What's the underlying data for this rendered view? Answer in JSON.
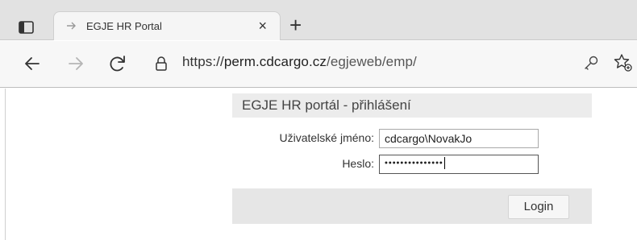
{
  "browser": {
    "tab": {
      "title": "EGJE HR Portal",
      "close_label": "×"
    },
    "new_tab_label": "+",
    "address_bar": {
      "url_prefix": "https://",
      "url_host": "perm.cdcargo.cz",
      "url_path": "/egjeweb/emp/"
    },
    "icons": {
      "tab_actions": "tab-actions-icon",
      "favicon": "page-favicon-icon",
      "back": "back-arrow-icon",
      "forward": "forward-arrow-icon",
      "reload": "reload-icon",
      "lock": "lock-icon",
      "password_key": "key-icon",
      "favorites": "add-favorite-icon"
    }
  },
  "page": {
    "title": "EGJE HR portál - přihlášení",
    "form": {
      "username_label": "Uživatelské jméno:",
      "username_value": "cdcargo\\NovakJo",
      "password_label": "Heslo:",
      "password_mask": "•••••••••••••••"
    },
    "login_button": "Login"
  }
}
